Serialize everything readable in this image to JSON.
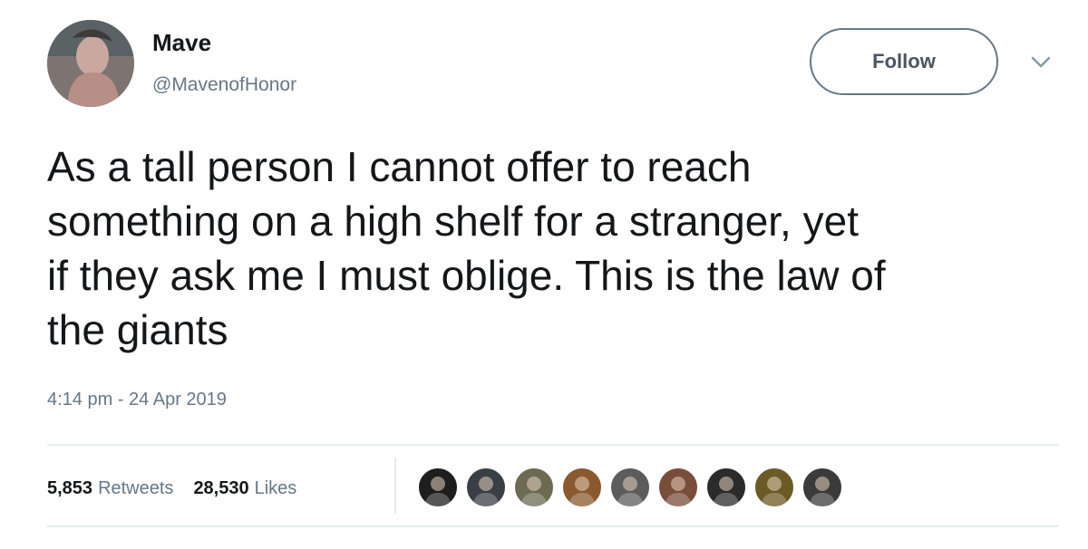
{
  "author": {
    "name": "Mave",
    "handle": "@MavenofHonor"
  },
  "follow_label": "Follow",
  "tweet": {
    "lines": [
      "As a tall person I cannot offer to reach",
      "something on a high shelf for a stranger, yet",
      "if they ask me I must oblige. This is the law of",
      "the giants"
    ],
    "timestamp": "4:14 pm - 24 Apr 2019"
  },
  "stats": {
    "retweets_count": "5,853",
    "retweets_label": "Retweets",
    "likes_count": "28,530",
    "likes_label": "Likes"
  },
  "liker_avatars": [
    {
      "icon": "liker-avatar-1",
      "color": "#1e1e1e"
    },
    {
      "icon": "liker-avatar-2",
      "color": "#3a3f46"
    },
    {
      "icon": "liker-avatar-3",
      "color": "#6d6a52"
    },
    {
      "icon": "liker-avatar-4",
      "color": "#8a5a2e"
    },
    {
      "icon": "liker-avatar-5",
      "color": "#5c5c5c"
    },
    {
      "icon": "liker-avatar-6",
      "color": "#7a4c3a"
    },
    {
      "icon": "liker-avatar-7",
      "color": "#2b2b2b"
    },
    {
      "icon": "liker-avatar-8",
      "color": "#6b5a24"
    },
    {
      "icon": "liker-avatar-9",
      "color": "#3b3b3b"
    }
  ],
  "colors": {
    "text_primary": "#14171a",
    "text_secondary": "#657786",
    "divider": "#e6ecf0"
  }
}
